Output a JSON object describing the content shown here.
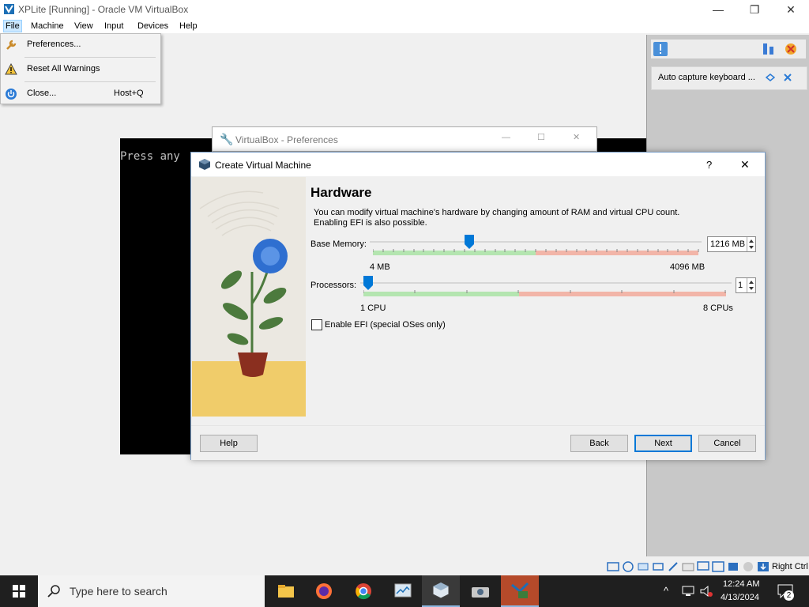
{
  "window": {
    "title": "XPLite [Running] - Oracle VM VirtualBox",
    "controls": [
      "—",
      "❐",
      "✕"
    ]
  },
  "menubar": {
    "items": [
      "File",
      "Machine",
      "View",
      "Input",
      "Devices",
      "Help"
    ]
  },
  "file_menu": {
    "items": [
      {
        "label": "Preferences...",
        "shortcut": "",
        "icon": "wrench-icon"
      },
      {
        "label": "Reset All Warnings",
        "shortcut": "",
        "icon": "warning-icon"
      },
      {
        "label": "Close...",
        "shortcut": "Host+Q",
        "icon": "power-icon"
      }
    ]
  },
  "console": {
    "text": "Press any"
  },
  "notification": {
    "text": "Auto capture keyboard ..."
  },
  "preferences_window": {
    "title": "VirtualBox - Preferences"
  },
  "dialog": {
    "title": "Create Virtual Machine",
    "help_glyph": "?",
    "close_glyph": "✕",
    "heading": "Hardware",
    "description": "You can modify virtual machine's hardware by changing amount of RAM and virtual CPU count. Enabling EFI is also possible.",
    "memory": {
      "label": "Base Memory:",
      "value": "1216 MB",
      "min_label": "4 MB",
      "max_label": "4096 MB",
      "fraction": 0.296
    },
    "processors": {
      "label": "Processors:",
      "value": "1",
      "min_label": "1 CPU",
      "max_label": "8 CPUs",
      "fraction": 0.0
    },
    "efi": {
      "label": "Enable EFI (special OSes only)",
      "checked": false
    },
    "buttons": {
      "help": "Help",
      "back": "Back",
      "next": "Next",
      "cancel": "Cancel"
    }
  },
  "statusbar": {
    "host_key": "Right Ctrl"
  },
  "taskbar": {
    "search_placeholder": "Type here to search",
    "time": "12:24 AM",
    "date": "4/13/2024",
    "notifications_count": "2"
  },
  "colors": {
    "accent": "#0078d7",
    "slider_green": "#b4e5b0",
    "slider_red": "#f2b5a8"
  }
}
